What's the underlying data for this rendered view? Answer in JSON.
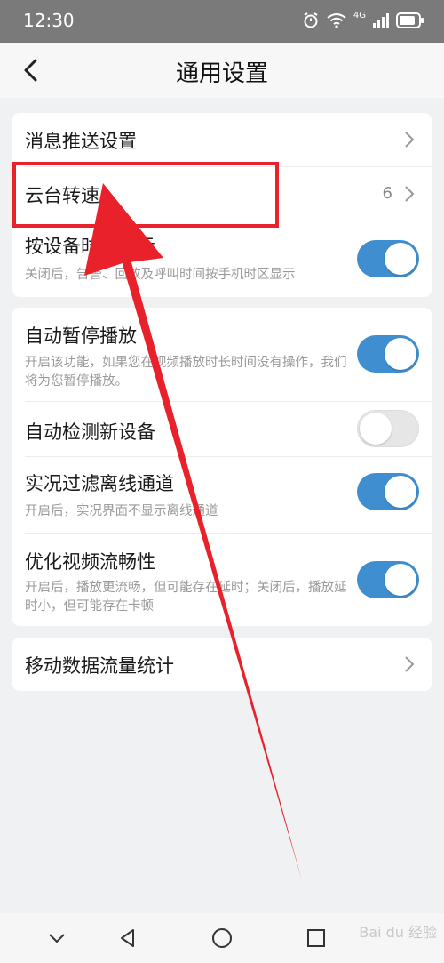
{
  "status_bar": {
    "time": "12:30",
    "network": "4G"
  },
  "header": {
    "title": "通用设置"
  },
  "group1": {
    "push": {
      "label": "消息推送设置"
    },
    "ptz": {
      "label": "云台转速",
      "value": "6"
    },
    "timezone": {
      "label": "按设备时区显示",
      "desc": "关闭后，告警、回放及呼叫时间按手机时区显示",
      "enabled": true
    }
  },
  "group2": {
    "autopause": {
      "label": "自动暂停播放",
      "desc": "开启该功能，如果您在视频播放时长时间没有操作，我们将为您暂停播放。",
      "enabled": true
    },
    "autodetect": {
      "label": "自动检测新设备",
      "enabled": false
    },
    "filter": {
      "label": "实况过滤离线通道",
      "desc": "开启后，实况界面不显示离线通道",
      "enabled": true
    },
    "smooth": {
      "label": "优化视频流畅性",
      "desc": "开启后，播放更流畅，但可能存在延时；关闭后，播放延时小，但可能存在卡顿",
      "enabled": true
    }
  },
  "group3": {
    "data_usage": {
      "label": "移动数据流量统计"
    }
  },
  "colors": {
    "toggle_on": "#3f8fd0",
    "annotation": "#e8212b"
  },
  "watermark": "Bai du 经验"
}
